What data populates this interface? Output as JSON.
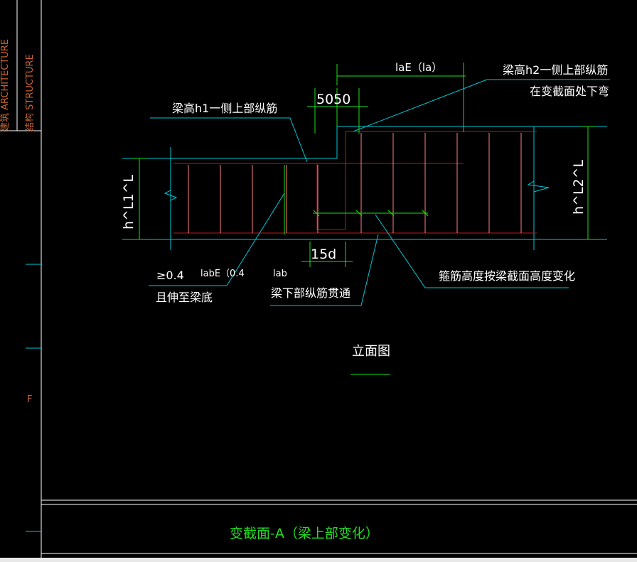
{
  "frame": {
    "architecture_label": "建筑 ARCHITECTURE",
    "structure_label": "结构 STRUCTURE",
    "grid_label": "F"
  },
  "dimensions": {
    "lae_label": "laE（la）",
    "offsets_label": "5050",
    "h1_label": "h^L1^L",
    "h2_label": "h^L2^L",
    "d15_label": "15d",
    "labe_label": "labE（0.4",
    "lab_label": "lab",
    "ge_label": "≥0.4"
  },
  "annotations": {
    "h1_top_bars": "梁高h1一侧上部纵筋",
    "h2_top_bars_line1": "梁高h2一侧上部纵筋",
    "h2_top_bars_line2": "在变截面处下弯",
    "extend_to_bottom": "且伸至梁底",
    "bottom_bars": "梁下部纵筋贯通",
    "stirrup_note": "箍筋高度按梁截面高度变化"
  },
  "view_label": "立面图",
  "drawing_title": "变截面-A（梁上部变化）",
  "colors": {
    "background": "#000000",
    "cyan": "#00c8d8",
    "green": "#19e019",
    "red": "#c01818",
    "pink": "#ff7f7f",
    "white": "#ffffff",
    "orange": "#cc6633"
  }
}
